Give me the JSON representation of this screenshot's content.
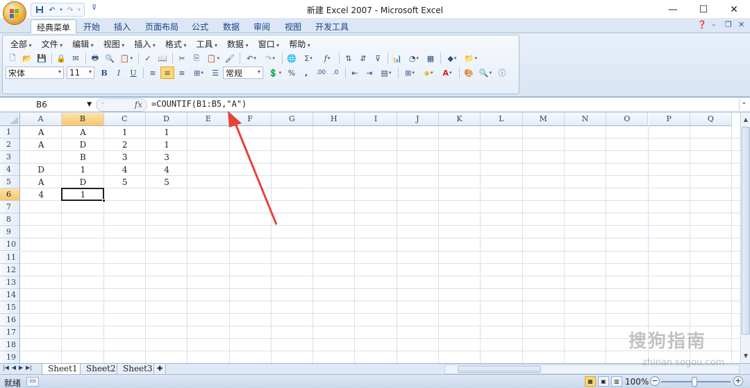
{
  "window": {
    "title": "新建 Excel 2007 - Microsoft Excel",
    "controls": [
      "—",
      "☐",
      "✕"
    ]
  },
  "qat": {
    "items": [
      "save-icon",
      "undo-icon",
      "redo-icon",
      "customize-icon"
    ],
    "undo": "↶",
    "redo": "↷",
    "more": "⊽"
  },
  "tabs": [
    "经典菜单",
    "开始",
    "插入",
    "页面布局",
    "公式",
    "数据",
    "审阅",
    "视图",
    "开发工具"
  ],
  "tabs_right": {
    "help": "❓",
    "min": "–",
    "restore": "❐",
    "close": "✕"
  },
  "menu": [
    "全部",
    "文件",
    "编辑",
    "视图",
    "插入",
    "格式",
    "工具",
    "数据",
    "窗口",
    "帮助"
  ],
  "toolbar": {
    "font_name": "宋体",
    "font_size": "11",
    "bold": "B",
    "italic": "I",
    "underline": "U",
    "number_format": "常规",
    "percent": "%",
    "comma": ",",
    "inc_decimal": ".00",
    "dec_decimal": ".0"
  },
  "formula_bar": {
    "name_box": "B6",
    "fx": "fx",
    "formula": "=COUNTIF(B1:B5,\"A\")"
  },
  "columns": [
    "A",
    "B",
    "C",
    "D",
    "E",
    "F",
    "G",
    "H",
    "I",
    "J",
    "K",
    "L",
    "M",
    "N",
    "O",
    "P",
    "Q"
  ],
  "rows": [
    "1",
    "2",
    "3",
    "4",
    "5",
    "6",
    "7",
    "8",
    "9",
    "10",
    "11",
    "12",
    "13",
    "14",
    "15",
    "16",
    "17",
    "18",
    "19"
  ],
  "active_cell": {
    "col": "B",
    "row": "6"
  },
  "cells": [
    {
      "ref": "A1",
      "value": "A"
    },
    {
      "ref": "B1",
      "value": "A"
    },
    {
      "ref": "C1",
      "value": "1"
    },
    {
      "ref": "D1",
      "value": "1"
    },
    {
      "ref": "A2",
      "value": "A"
    },
    {
      "ref": "B2",
      "value": "D"
    },
    {
      "ref": "C2",
      "value": "2"
    },
    {
      "ref": "D2",
      "value": "1"
    },
    {
      "ref": "B3",
      "value": "B"
    },
    {
      "ref": "C3",
      "value": "3"
    },
    {
      "ref": "D3",
      "value": "3"
    },
    {
      "ref": "A4",
      "value": "D"
    },
    {
      "ref": "B4",
      "value": "1"
    },
    {
      "ref": "C4",
      "value": "4"
    },
    {
      "ref": "D4",
      "value": "4"
    },
    {
      "ref": "A5",
      "value": "A"
    },
    {
      "ref": "B5",
      "value": "D"
    },
    {
      "ref": "C5",
      "value": "5"
    },
    {
      "ref": "D5",
      "value": "5"
    },
    {
      "ref": "A6",
      "value": "4"
    },
    {
      "ref": "B6",
      "value": "1"
    }
  ],
  "sheets": [
    "Sheet1",
    "Sheet2",
    "Sheet3"
  ],
  "active_sheet": "Sheet1",
  "status": {
    "ready": "就绪",
    "zoom": "100%",
    "zoom_out": "−",
    "zoom_in": "+"
  },
  "watermark": {
    "brand": "搜狗指南",
    "url": "zhinan.sogou.com"
  },
  "colors": {
    "accent": "#15428b",
    "ribbon": "#dfe8f5",
    "selected_header": "#f9c66b",
    "arrow": "#e8413a"
  }
}
